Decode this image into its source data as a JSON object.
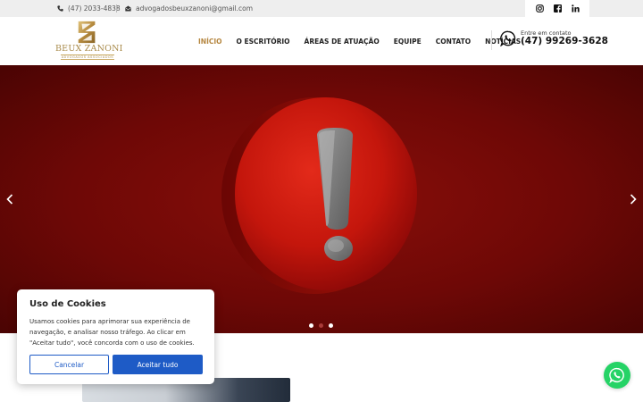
{
  "topbar": {
    "phone": "(47) 2033-4838",
    "email": "advogadosbeuxzanoni@gmail.com",
    "social": [
      "instagram",
      "facebook",
      "linkedin"
    ]
  },
  "logo": {
    "name": "BEUX ZANONI",
    "tagline": "ADVOGADOS ASSOCIADOS"
  },
  "nav": {
    "items": [
      "INÍCIO",
      "O ESCRITÓRIO",
      "ÁREAS DE ATUAÇÃO",
      "EQUIPE",
      "CONTATO",
      "NOTÍCIAS"
    ],
    "active": 0
  },
  "whatsapp": {
    "label": "Entre em contato",
    "number": "(47) 99269-3628"
  },
  "hero": {
    "slides": 3,
    "current": 0
  },
  "cookie": {
    "title": "Uso de Cookies",
    "text": "Usamos cookies para aprimorar sua experiência de navegação, e analisar nosso tráfego. Ao clicar em \"Aceitar tudo\", você concorda com o uso de cookies.",
    "cancel_label": "Cancelar",
    "accept_label": "Aceitar tudo"
  },
  "colors": {
    "accent_gold": "#b5863f",
    "hero_red": "#7a0a07",
    "button_blue": "#1e5bc6",
    "whatsapp_green": "#25d366"
  }
}
